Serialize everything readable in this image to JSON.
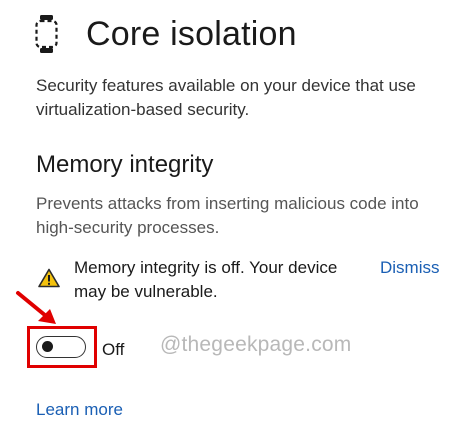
{
  "page_title": "Core isolation",
  "intro_text": "Security features available on your device that use virtualization-based security.",
  "memory_integrity": {
    "heading": "Memory integrity",
    "description": "Prevents attacks from inserting malicious code into high-security processes.",
    "warning_text": "Memory integrity is off. Your device may be vulnerable.",
    "dismiss_label": "Dismiss",
    "toggle_state": "Off",
    "toggle_on": false
  },
  "learn_more_label": "Learn more",
  "watermark": "@thegeekpage.com",
  "icons": {
    "header": "core-isolation-chip-icon",
    "warning": "warning-triangle-icon",
    "annotation_arrow": "red-arrow-icon"
  },
  "colors": {
    "link": "#1a5fb4",
    "warning_fill": "#f4c20d",
    "annotation": "#e00000"
  }
}
